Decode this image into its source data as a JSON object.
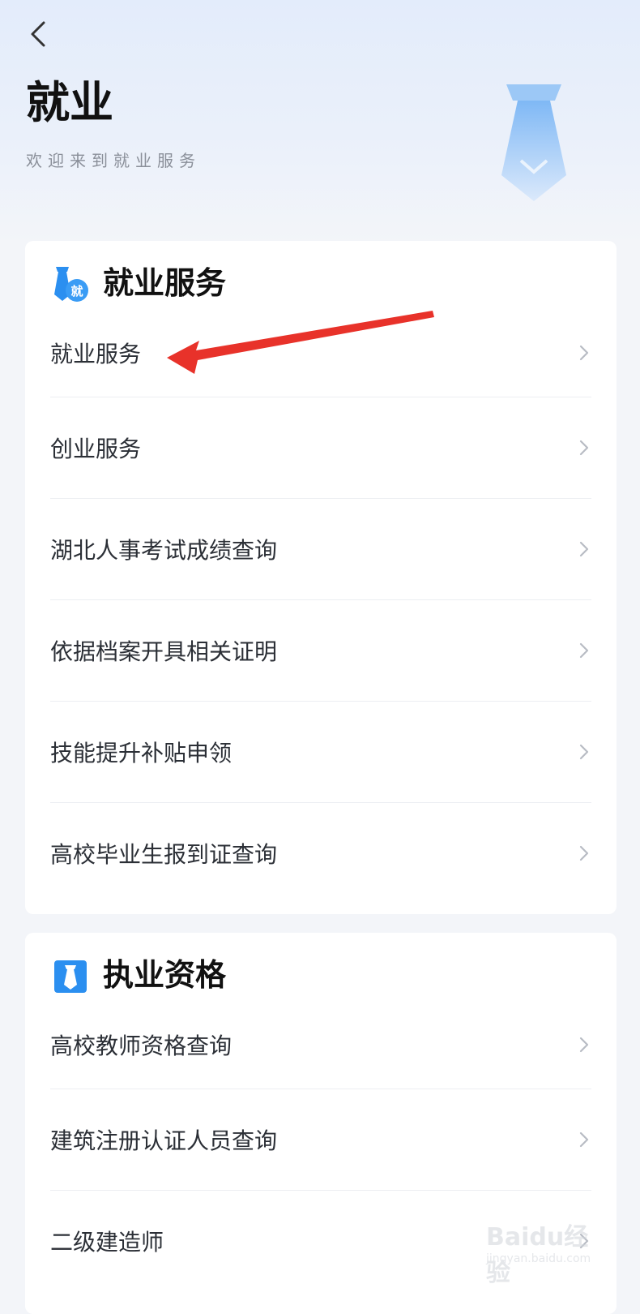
{
  "header": {
    "title": "就业",
    "subtitle": "欢迎来到就业服务"
  },
  "sections": [
    {
      "title": "就业服务",
      "icon": "tie-badge-icon",
      "items": [
        "就业服务",
        "创业服务",
        "湖北人事考试成绩查询",
        "依据档案开具相关证明",
        "技能提升补贴申领",
        "高校毕业生报到证查询"
      ]
    },
    {
      "title": "执业资格",
      "icon": "tie-square-icon",
      "items": [
        "高校教师资格查询",
        "建筑注册认证人员查询",
        "二级建造师"
      ]
    }
  ],
  "watermark": {
    "brand": "Baidu经验",
    "url": "jingyan.baidu.com"
  },
  "colors": {
    "accent": "#2b8ff0",
    "annotation_arrow": "#e8322a",
    "background": "#f3f5f9"
  }
}
